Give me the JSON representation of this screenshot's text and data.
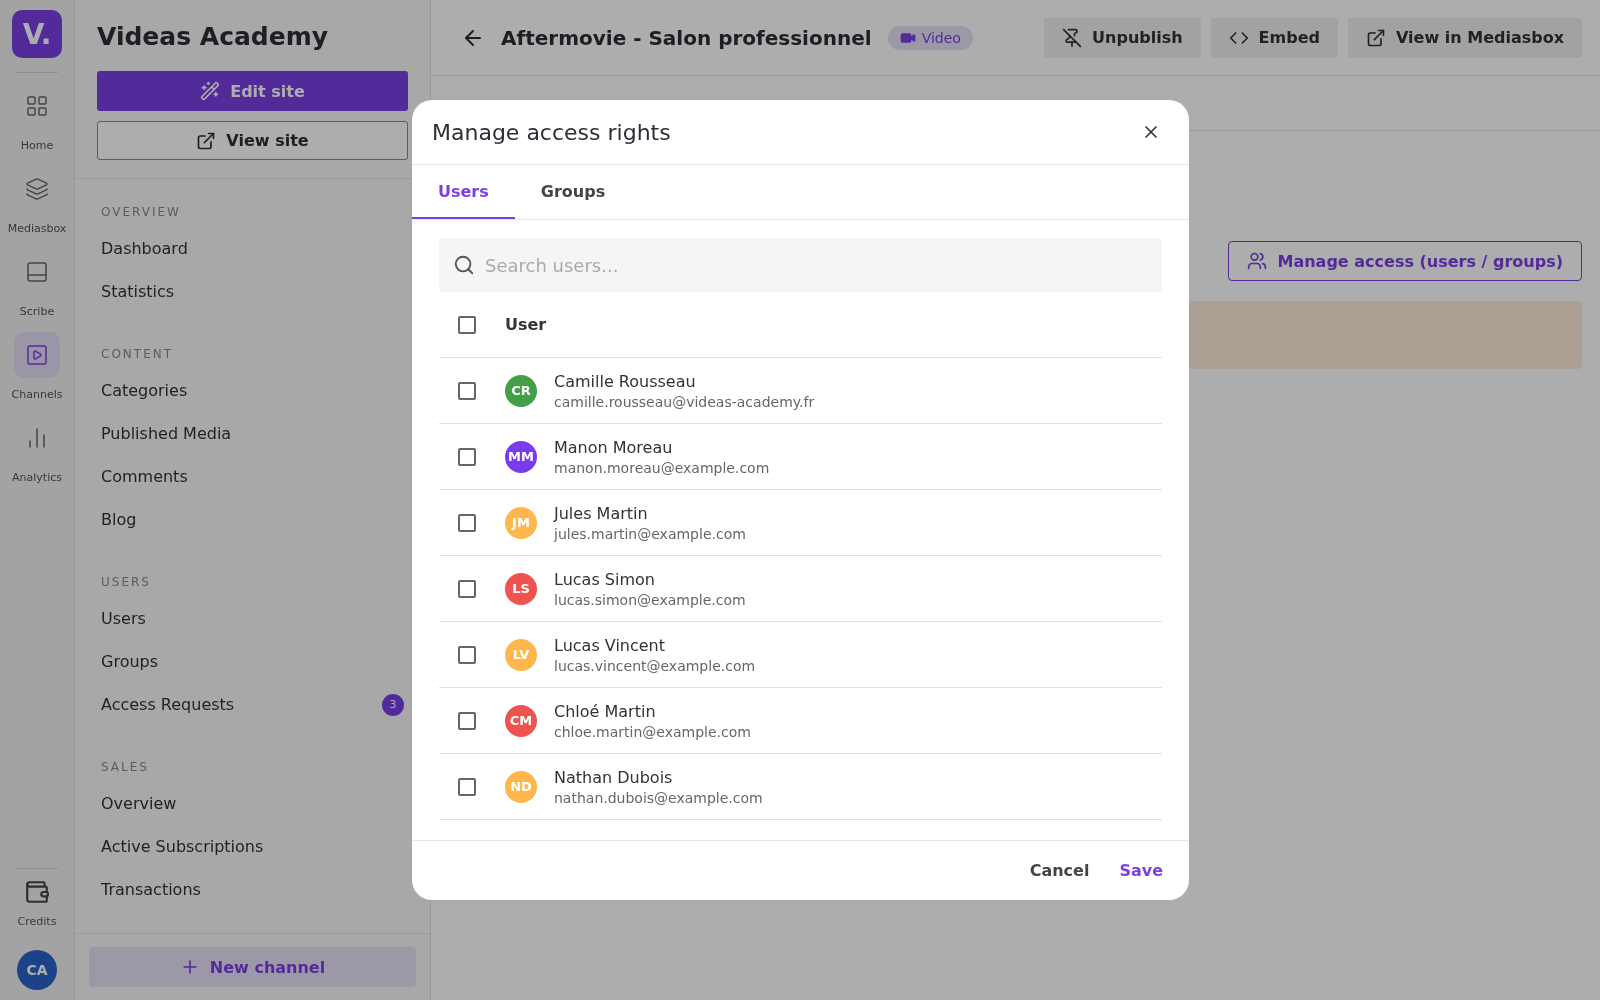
{
  "rail": {
    "logo": "V.",
    "items": [
      {
        "label": "Home",
        "kind": "grid",
        "selected": false
      },
      {
        "label": "Mediasbox",
        "kind": "layers",
        "selected": false
      },
      {
        "label": "Scribe",
        "kind": "card",
        "selected": false
      },
      {
        "label": "Channels",
        "kind": "play",
        "selected": true
      },
      {
        "label": "Analytics",
        "kind": "bars",
        "selected": false
      }
    ],
    "bottom": {
      "label": "Credits"
    },
    "avatar": "CA"
  },
  "sidebar": {
    "title": "Videas Academy",
    "edit_button": "Edit site",
    "view_button": "View site",
    "sections": [
      {
        "heading": "OVERVIEW",
        "items": [
          {
            "label": "Dashboard"
          },
          {
            "label": "Statistics"
          }
        ]
      },
      {
        "heading": "CONTENT",
        "items": [
          {
            "label": "Categories"
          },
          {
            "label": "Published Media"
          },
          {
            "label": "Comments"
          },
          {
            "label": "Blog"
          }
        ]
      },
      {
        "heading": "USERS",
        "items": [
          {
            "label": "Users"
          },
          {
            "label": "Groups"
          },
          {
            "label": "Access Requests",
            "badge": "3"
          }
        ]
      },
      {
        "heading": "SALES",
        "items": [
          {
            "label": "Overview"
          },
          {
            "label": "Active Subscriptions"
          },
          {
            "label": "Transactions"
          }
        ]
      }
    ],
    "new_button": "New channel"
  },
  "header": {
    "title": "Aftermovie - Salon professionnel",
    "badge": "Video",
    "actions": [
      {
        "label": "Unpublish",
        "kind": "unpublish"
      },
      {
        "label": "Embed",
        "kind": "code"
      },
      {
        "label": "View in Mediasbox",
        "kind": "external"
      }
    ]
  },
  "content": {
    "manage_button": "Manage access (users / groups)"
  },
  "modal": {
    "title": "Manage access rights",
    "tabs": [
      {
        "label": "Users",
        "selected": true
      },
      {
        "label": "Groups",
        "selected": false
      }
    ],
    "search": {
      "placeholder": "Search users..."
    },
    "table": {
      "header": "User",
      "header_checked": false,
      "rows": [
        {
          "initials": "CR",
          "color": "#43a047",
          "name": "Camille Rousseau",
          "email": "camille.rousseau@videas-academy.fr",
          "checked": false
        },
        {
          "initials": "MM",
          "color": "#7c3aed",
          "name": "Manon Moreau",
          "email": "manon.moreau@example.com",
          "checked": false
        },
        {
          "initials": "JM",
          "color": "#ffb74d",
          "name": "Jules Martin",
          "email": "jules.martin@example.com",
          "checked": false
        },
        {
          "initials": "LS",
          "color": "#ef5350",
          "name": "Lucas Simon",
          "email": "lucas.simon@example.com",
          "checked": false
        },
        {
          "initials": "LV",
          "color": "#ffb74d",
          "name": "Lucas Vincent",
          "email": "lucas.vincent@example.com",
          "checked": false
        },
        {
          "initials": "CM",
          "color": "#ef5350",
          "name": "Chloé Martin",
          "email": "chloe.martin@example.com",
          "checked": false
        },
        {
          "initials": "ND",
          "color": "#ffb74d",
          "name": "Nathan Dubois",
          "email": "nathan.dubois@example.com",
          "checked": false
        }
      ]
    },
    "buttons": [
      {
        "label": "Cancel",
        "kind": "secondary"
      },
      {
        "label": "Save",
        "kind": "primary"
      }
    ]
  }
}
